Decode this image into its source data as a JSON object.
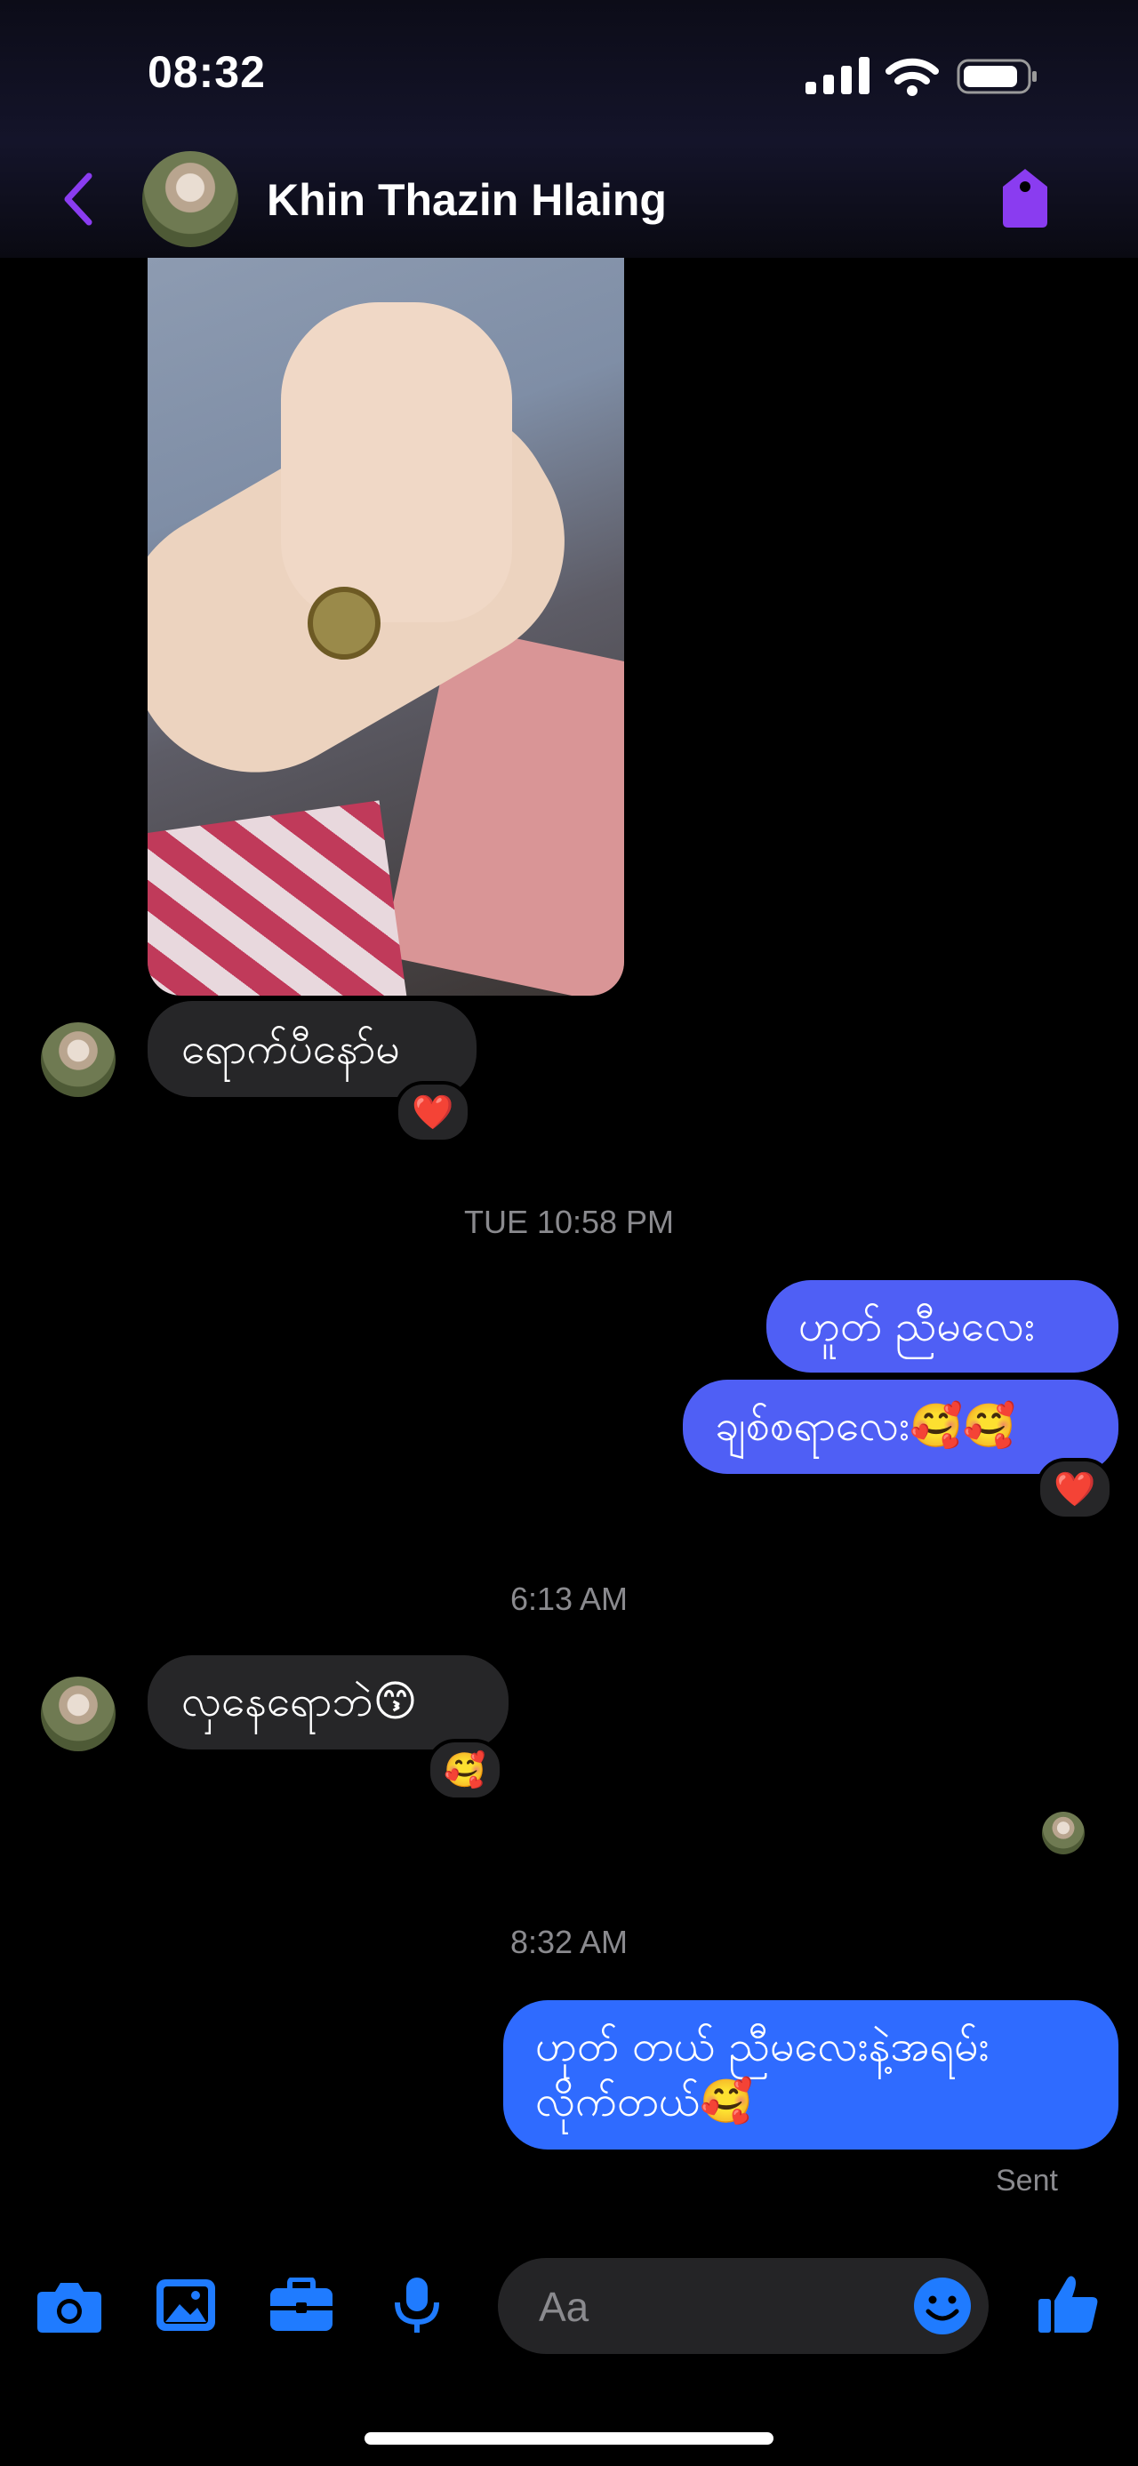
{
  "status_bar": {
    "time": "08:32"
  },
  "header": {
    "contact_name": "Khin Thazin Hlaing"
  },
  "colors": {
    "accent": "#8a3cf0",
    "outgoing": "#4f5ff5",
    "outgoing_latest": "#2f6bff",
    "incoming": "#262628",
    "icon_blue": "#1f7bff"
  },
  "messages": [
    {
      "side": "in",
      "text": "ရောက်ပီနော်မ",
      "reaction": "❤️"
    },
    {
      "side": "timestamp",
      "text": "TUE 10:58 PM"
    },
    {
      "side": "out",
      "text": "ဟူတ် ညီမလေး"
    },
    {
      "side": "out",
      "text": "ချစ်စရာလေး🥰🥰",
      "reaction": "❤️"
    },
    {
      "side": "timestamp",
      "text": "6:13 AM"
    },
    {
      "side": "in",
      "text": "လှနေရောဘဲ😙",
      "reaction": "🥰"
    },
    {
      "side": "timestamp",
      "text": "8:32 AM"
    },
    {
      "side": "out",
      "text_line1": "ဟုတ် တယ် ညီမလေးနဲ့အရမ်း",
      "text_line2": "လိုက်တယ်🥰"
    }
  ],
  "delivery_status": "Sent",
  "composer": {
    "placeholder": "Aa"
  },
  "icons": [
    "back-icon",
    "tag-icon",
    "camera-icon",
    "image-icon",
    "briefcase-icon",
    "microphone-icon",
    "emoji-icon",
    "thumbs-up-icon"
  ]
}
